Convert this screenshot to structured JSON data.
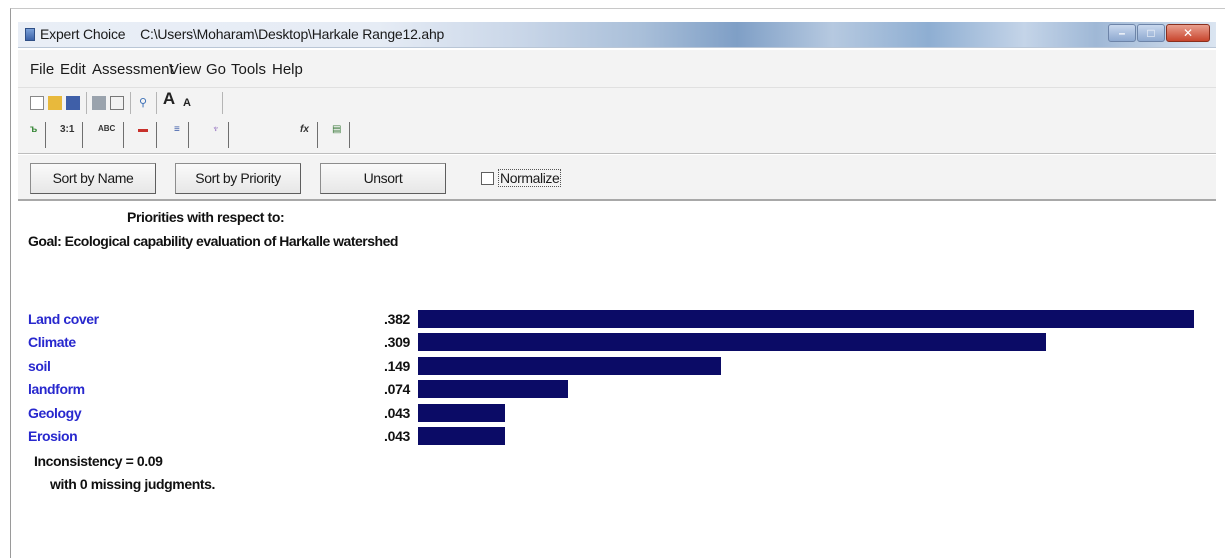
{
  "window": {
    "app_name": "Expert Choice",
    "file_path": "C:\\Users\\Moharam\\Desktop\\Harkale Range12.ahp"
  },
  "menu": [
    "File",
    "Edit",
    "Assessment",
    "View",
    "Go",
    "Tools",
    "Help"
  ],
  "toolbar": {
    "tabs": [
      "3:1",
      "ABC"
    ]
  },
  "sortbar": {
    "sort_by_name": "Sort by Name",
    "sort_by_priority": "Sort by Priority",
    "unsort": "Unsort",
    "normalize": "Normalize",
    "normalize_checked": false
  },
  "content": {
    "heading": "Priorities with respect to:",
    "goal": "Goal: Ecological capability evaluation of Harkalle watershed",
    "bar_color": "#0b0b66",
    "label_color": "#2828ce",
    "inconsistency": "Inconsistency = 0.09",
    "missing": "with 0  missing judgments."
  },
  "chart_data": {
    "type": "bar",
    "orientation": "horizontal",
    "categories": [
      "Land cover",
      "Climate",
      "soil",
      "landform",
      "Geology",
      "Erosion"
    ],
    "values": [
      0.382,
      0.309,
      0.149,
      0.074,
      0.043,
      0.043
    ],
    "value_labels": [
      ".382",
      ".309",
      ".149",
      ".074",
      ".043",
      ".043"
    ]
  }
}
